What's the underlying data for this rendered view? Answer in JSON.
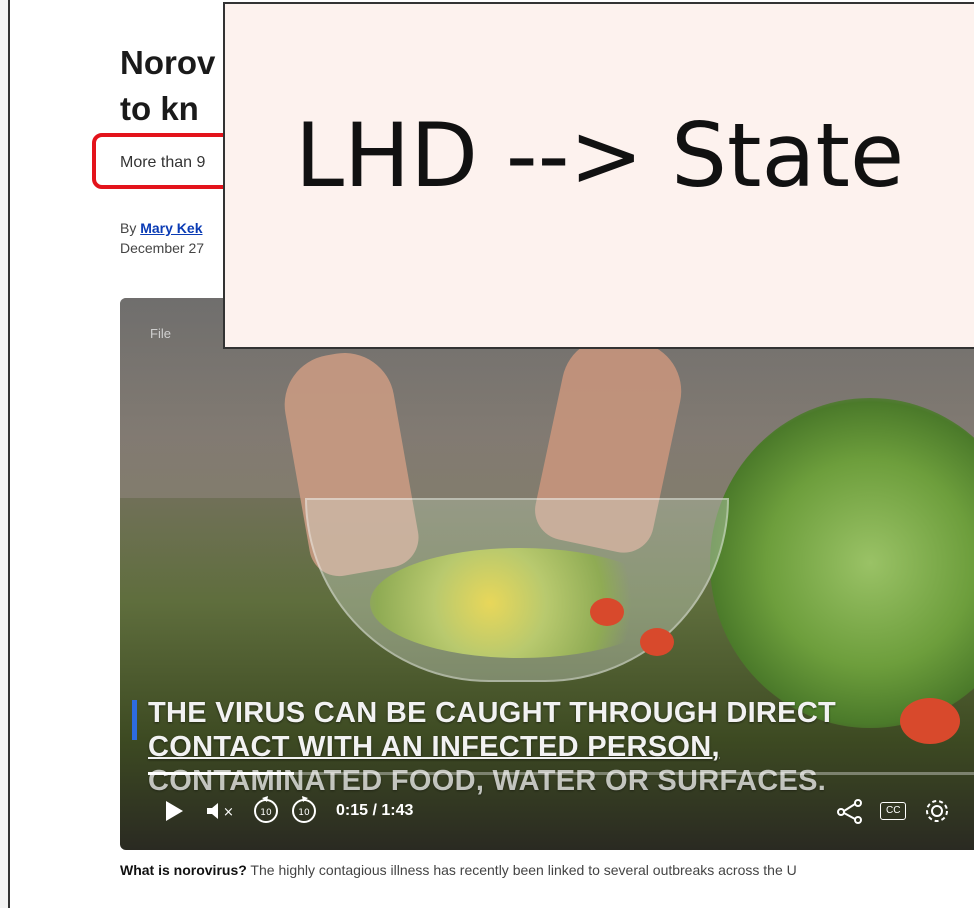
{
  "article": {
    "headline_line1": "Norov",
    "headline_line2": "to kn",
    "dek": "More than 9",
    "byline_prefix": "By",
    "author": "Mary Kek",
    "date": "December 27"
  },
  "overlay": {
    "text": "LHD --> State"
  },
  "video": {
    "file_label": "File",
    "caption_line1": "THE VIRUS CAN BE CAUGHT THROUGH DIRECT",
    "caption_line2": "CONTACT WITH AN INFECTED PERSON,",
    "caption_line3": "CONTAMINATED FOOD, WATER OR SURFACES.",
    "current_time": "0:15",
    "duration": "/ 1:43",
    "progress": 0.17,
    "cc_label": "CC",
    "rewind_label": "10",
    "forward_label": "10"
  },
  "caption": {
    "bold": "What is norovirus?",
    "text": " The highly contagious illness has recently been linked to several outbreaks across the U"
  },
  "colors": {
    "highlight": "#e3131b",
    "link": "#0a3bb5",
    "overlay_bg": "#fdf2ee"
  }
}
